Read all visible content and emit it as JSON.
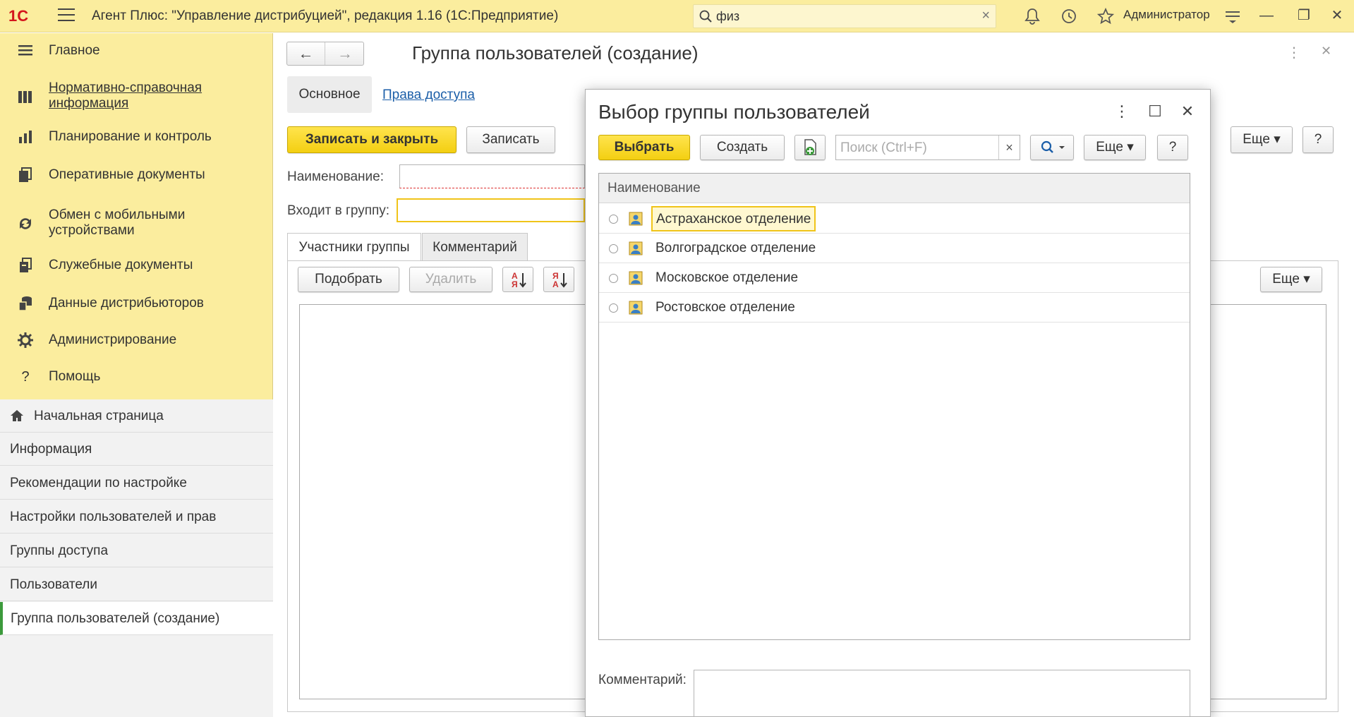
{
  "topbar": {
    "logo": "1С",
    "title": "Агент Плюс: \"Управление дистрибуцией\", редакция 1.16  (1С:Предприятие)",
    "search_value": "физ",
    "user": "Администратор"
  },
  "sidebar": {
    "sections": [
      {
        "label": "Главное",
        "icon": "list-icon"
      },
      {
        "label": "Нормативно-справочная информация",
        "icon": "catalog-icon"
      },
      {
        "label": "Планирование и контроль",
        "icon": "chart-icon"
      },
      {
        "label": "Оперативные документы",
        "icon": "documents-icon"
      },
      {
        "label": "Обмен с мобильными устройствами",
        "icon": "sync-icon"
      },
      {
        "label": "Служебные документы",
        "icon": "service-docs-icon"
      },
      {
        "label": "Данные дистрибьюторов",
        "icon": "distributor-data-icon"
      },
      {
        "label": "Администрирование",
        "icon": "gear-icon"
      },
      {
        "label": "Помощь",
        "icon": "help-icon"
      }
    ],
    "nav": [
      {
        "label": "Начальная страница"
      },
      {
        "label": "Информация"
      },
      {
        "label": "Рекомендации по настройке"
      },
      {
        "label": "Настройки пользователей и прав"
      },
      {
        "label": "Группы доступа"
      },
      {
        "label": "Пользователи"
      },
      {
        "label": "Группа пользователей (создание)"
      }
    ]
  },
  "form": {
    "title": "Группа пользователей (создание)",
    "tabs": {
      "main": "Основное",
      "access": "Права доступа"
    },
    "save_close": "Записать и закрыть",
    "save": "Записать",
    "more": "Еще",
    "help": "?",
    "name_label": "Наименование:",
    "name_value": "",
    "parent_label": "Входит в группу:",
    "parent_value": "",
    "subtabs": {
      "members": "Участники группы",
      "comment": "Комментарий"
    },
    "pick": "Подобрать",
    "delete": "Удалить",
    "sort_up_letters": "АЯ",
    "sort_down_letters": "ЯА",
    "more2": "Еще"
  },
  "dialog": {
    "title": "Выбор группы пользователей",
    "select": "Выбрать",
    "create": "Создать",
    "search_placeholder": "Поиск (Ctrl+F)",
    "more": "Еще",
    "help": "?",
    "column": "Наименование",
    "rows": [
      {
        "label": "Астраханское отделение",
        "selected": true
      },
      {
        "label": "Волгоградское отделение",
        "selected": false
      },
      {
        "label": "Московское отделение",
        "selected": false
      },
      {
        "label": "Ростовское отделение",
        "selected": false
      }
    ],
    "comment_label": "Комментарий:",
    "comment_value": ""
  },
  "colors": {
    "panel_yellow": "#fbed9e",
    "primary_button": "#f3cf12",
    "link": "#1b5ea8",
    "active_nav_marker": "#3c9a3c",
    "logo_red": "#d4161c"
  }
}
